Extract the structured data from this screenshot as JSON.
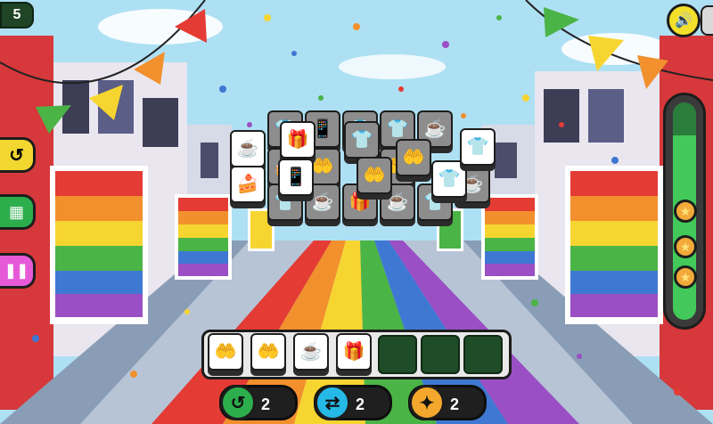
{
  "level": {
    "number": "5"
  },
  "controls": {
    "sound_icon": "speaker-icon",
    "fullscreen_icon": "fullscreen-icon",
    "undo_icon": "undo-icon",
    "menu_icon": "grid-icon",
    "pause_icon": "pause-icon"
  },
  "progress": {
    "fill_fraction": 0.85,
    "stars": 3
  },
  "powerups": [
    {
      "name": "undo",
      "icon": "undo-icon",
      "count": "2",
      "color": "#2cae4d"
    },
    {
      "name": "shuffle",
      "icon": "shuffle-icon",
      "count": "2",
      "color": "#26b9e8"
    },
    {
      "name": "hint",
      "icon": "magic-wand-icon",
      "count": "2",
      "color": "#f3a72c"
    }
  ],
  "tray": {
    "capacity": 7,
    "tiles": [
      "rainbow-heart-hand",
      "rainbow-heart-hand",
      "coffee-cup",
      "gift-box"
    ]
  },
  "colors": {
    "sky": "#aee0f4",
    "rainbow": [
      "#e43b35",
      "#f2902d",
      "#f7d531",
      "#4bb446",
      "#3e78d3",
      "#9a4fc4"
    ],
    "progress_green": "#42c95a"
  }
}
